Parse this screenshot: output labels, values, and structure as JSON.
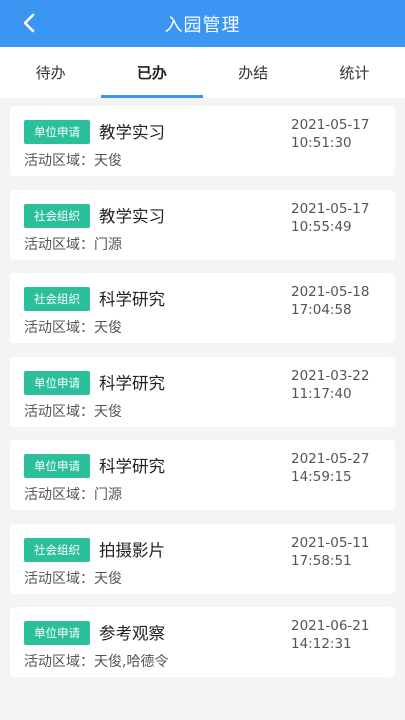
{
  "header": {
    "title": "入园管理",
    "back_icon": "chevron-left-icon"
  },
  "colors": {
    "header_bg": "#3a95f3",
    "tab_indicator": "#3a95f3",
    "badge_bg": "#2cbf9b",
    "page_bg": "#f3f4f6"
  },
  "tabs": [
    {
      "label": "待办",
      "active": false
    },
    {
      "label": "已办",
      "active": true
    },
    {
      "label": "办结",
      "active": false
    },
    {
      "label": "统计",
      "active": false
    }
  ],
  "records": [
    {
      "type": "单位申请",
      "title": "教学实习",
      "area_label": "活动区域：",
      "area": "天俊",
      "date": "2021-05-17",
      "time": "10:51:30"
    },
    {
      "type": "社会组织",
      "title": "教学实习",
      "area_label": "活动区域：",
      "area": "门源",
      "date": "2021-05-17",
      "time": "10:55:49"
    },
    {
      "type": "社会组织",
      "title": "科学研究",
      "area_label": "活动区域：",
      "area": "天俊",
      "date": "2021-05-18",
      "time": "17:04:58"
    },
    {
      "type": "单位申请",
      "title": "科学研究",
      "area_label": "活动区域：",
      "area": "天俊",
      "date": "2021-03-22",
      "time": "11:17:40"
    },
    {
      "type": "单位申请",
      "title": "科学研究",
      "area_label": "活动区域：",
      "area": "门源",
      "date": "2021-05-27",
      "time": "14:59:15"
    },
    {
      "type": "社会组织",
      "title": "拍摄影片",
      "area_label": "活动区域：",
      "area": "天俊",
      "date": "2021-05-11",
      "time": "17:58:51"
    },
    {
      "type": "单位申请",
      "title": "参考观察",
      "area_label": "活动区域：",
      "area": "天俊,哈德令",
      "date": "2021-06-21",
      "time": "14:12:31"
    }
  ]
}
